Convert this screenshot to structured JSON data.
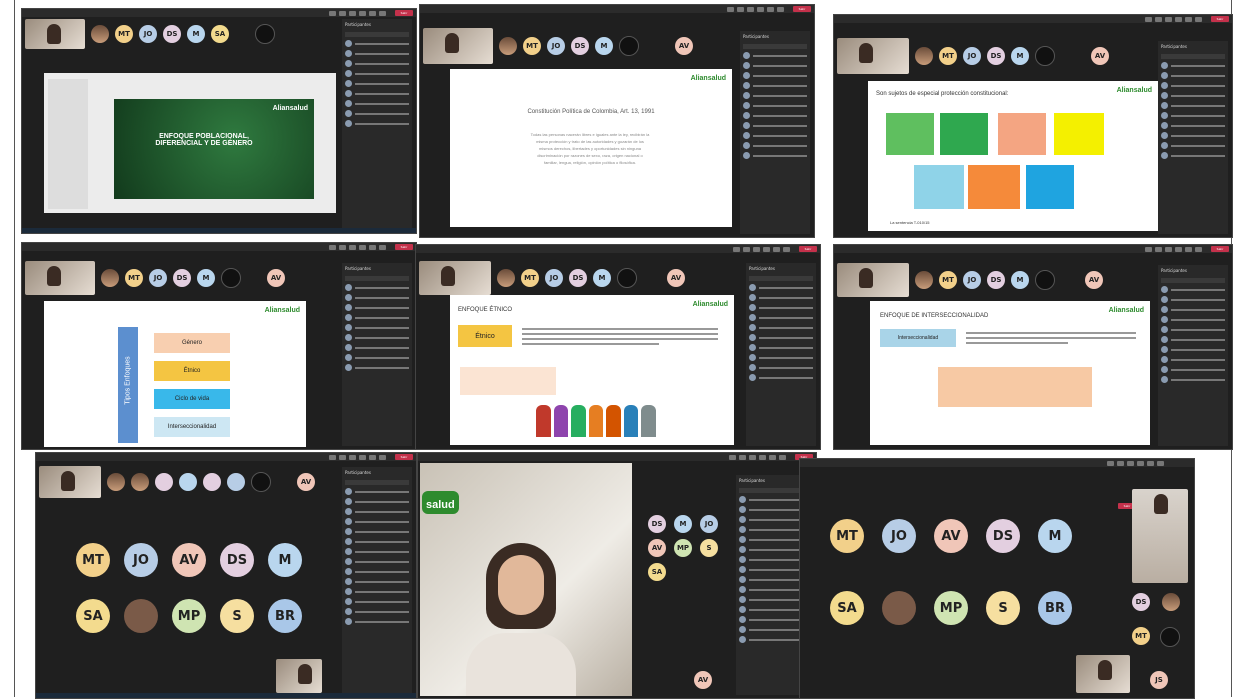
{
  "participants_title": "Participantes",
  "leave_label": "Salir",
  "slides": {
    "s1_title": "ENFOQUE POBLACIONAL, DIFERENCIAL Y DE GÉNERO",
    "s2_title": "Constitución Política de Colombia, Art. 13, 1991",
    "s2_body": "Todas las personas nacerán libres e iguales ante la ley, recibirán la misma protección y trato de las autoridades y gozarán de los mismos derechos, libertades y oportunidades sin ninguna discriminación por razones de sexo, raza, origen nacional o familiar, lengua, religión, opinión política o filosófica.",
    "s3_title": "Son sujetos de especial protección constitucional:",
    "s3_footer": "La sentencia T-010/15",
    "s4_vertical": "Tipos Enfoques",
    "s4_items": [
      "Género",
      "Étnico",
      "Ciclo de vida",
      "Interseccionalidad"
    ],
    "s5_title": "ENFOQUE ÉTNICO",
    "s5_tag": "Étnico",
    "s6_title": "ENFOQUE DE INTERSECCIONALIDAD",
    "s6_tag": "Interseccionalidad",
    "logo": "Aliansalud",
    "logo_short": "salud"
  },
  "attendees_top": [
    "MT",
    "JO",
    "DS",
    "M",
    "SA"
  ],
  "attendees_grid": [
    {
      "initials": "MT",
      "color": "#f2d08a"
    },
    {
      "initials": "JO",
      "color": "#b7cde6"
    },
    {
      "initials": "AV",
      "color": "#f0c6b8"
    },
    {
      "initials": "DS",
      "color": "#e3cfe0"
    },
    {
      "initials": "M",
      "color": "#b9d6ee"
    },
    {
      "initials": "SA",
      "color": "#f3db8e"
    },
    {
      "initials": "",
      "color": "#7a5a48"
    },
    {
      "initials": "MP",
      "color": "#cfe4b2"
    },
    {
      "initials": "S",
      "color": "#f6dfa0"
    },
    {
      "initials": "BR",
      "color": "#a9c7e8"
    }
  ],
  "side_initials": [
    "DS",
    "M",
    "JO",
    "AV",
    "MP",
    "S",
    "SA"
  ],
  "self_initials": "AV",
  "extra_initials": "JS"
}
